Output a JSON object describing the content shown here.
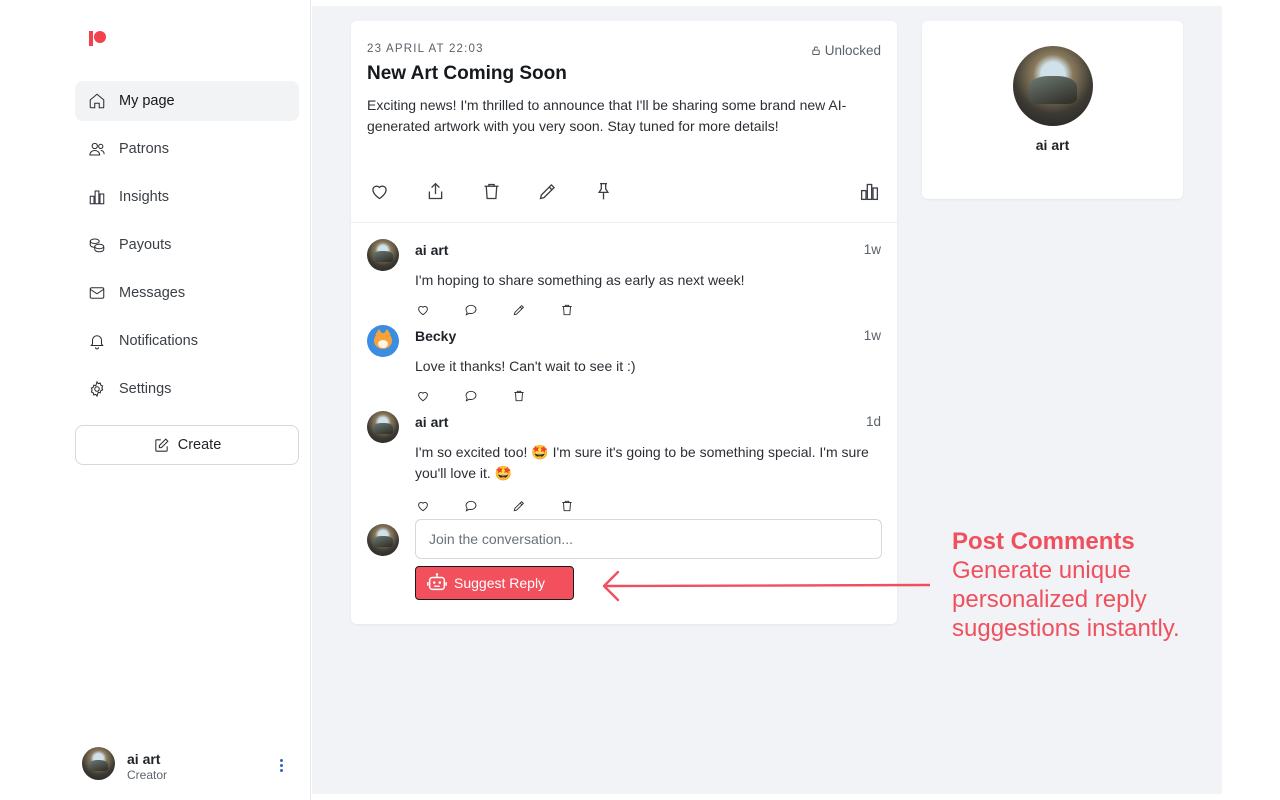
{
  "sidebar": {
    "items": [
      {
        "label": "My page",
        "icon": "home-icon",
        "active": true
      },
      {
        "label": "Patrons",
        "icon": "users-icon"
      },
      {
        "label": "Insights",
        "icon": "bar-chart-icon"
      },
      {
        "label": "Payouts",
        "icon": "coins-icon"
      },
      {
        "label": "Messages",
        "icon": "mail-icon"
      },
      {
        "label": "Notifications",
        "icon": "bell-icon"
      },
      {
        "label": "Settings",
        "icon": "gear-icon"
      }
    ],
    "create_label": "Create",
    "profile": {
      "name": "ai art",
      "role": "Creator"
    }
  },
  "post": {
    "date": "23 APRIL AT 22:03",
    "lock_status": "Unlocked",
    "title": "New Art Coming Soon",
    "body": "Exciting news! I'm thrilled to announce that I'll be sharing some brand new AI-generated artwork with you very soon. Stay tuned for more details!",
    "comments": [
      {
        "author": "ai art",
        "time": "1w",
        "text": "I'm hoping to share something as early as next week!"
      },
      {
        "author": "Becky",
        "time": "1w",
        "text": "Love it thanks! Can't wait to see it :)"
      },
      {
        "author": "ai art",
        "time": "1d",
        "text": "I'm so excited too! 🤩 I'm sure it's going to be something special. I'm sure you'll love it. 🤩"
      }
    ],
    "reply_placeholder": "Join the conversation...",
    "suggest_label": "Suggest Reply"
  },
  "side_card": {
    "name": "ai art"
  },
  "annotation": {
    "heading": "Post Comments",
    "line1": "Generate unique",
    "line2": "personalized reply",
    "line3": "suggestions instantly."
  },
  "colors": {
    "brand": "#f2414f",
    "accent": "#f2505c",
    "background": "#f1f3f6"
  }
}
